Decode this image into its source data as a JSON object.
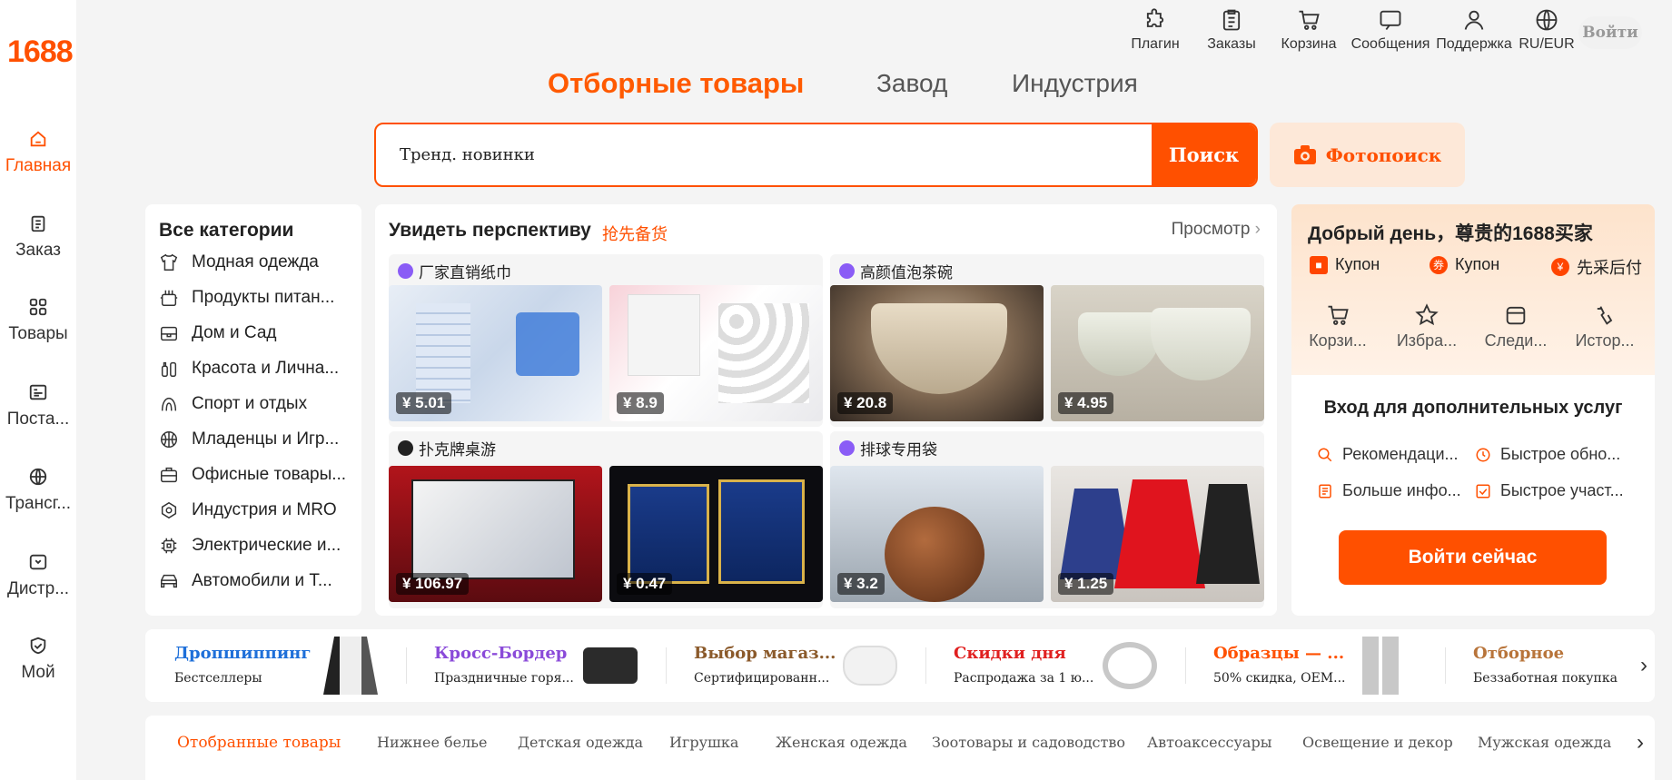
{
  "brand": {
    "logo": "1688"
  },
  "sidebar": {
    "items": [
      {
        "label": "Главная",
        "icon": "home-icon",
        "active": true
      },
      {
        "label": "Заказ",
        "icon": "clipboard-icon"
      },
      {
        "label": "Товары",
        "icon": "grid-icon"
      },
      {
        "label": "Поста...",
        "icon": "supplier-icon"
      },
      {
        "label": "Трансг...",
        "icon": "globe-icon"
      },
      {
        "label": "Дистр...",
        "icon": "distribution-icon"
      },
      {
        "label": "Мой",
        "icon": "user-badge-icon"
      }
    ]
  },
  "topbar": {
    "items": [
      {
        "label": "Плагин",
        "icon": "puzzle-icon"
      },
      {
        "label": "Заказы",
        "icon": "clipboard-icon"
      },
      {
        "label": "Корзина",
        "icon": "cart-icon"
      },
      {
        "label": "Сообщения",
        "icon": "message-icon"
      },
      {
        "label": "Поддержка",
        "icon": "person-icon"
      },
      {
        "label": "RU/EUR",
        "icon": "globe-icon"
      }
    ],
    "login": "Войти"
  },
  "tabs": {
    "selected": "Отборные товары",
    "factory": "Завод",
    "industry": "Индустрия"
  },
  "search": {
    "value": "Тренд. новинки",
    "button": "Поиск",
    "photo_button": "Фотопоиск"
  },
  "categories": {
    "title": "Все категории",
    "items": [
      {
        "label": "Модная одежда",
        "icon": "shirt-icon"
      },
      {
        "label": "Продукты питан...",
        "icon": "food-icon"
      },
      {
        "label": "Дом и Сад",
        "icon": "home-garden-icon"
      },
      {
        "label": "Красота и Лична...",
        "icon": "beauty-icon"
      },
      {
        "label": "Спорт и отдых",
        "icon": "sport-icon"
      },
      {
        "label": "Младенцы и Игр...",
        "icon": "ball-icon"
      },
      {
        "label": "Офисные товары...",
        "icon": "briefcase-icon"
      },
      {
        "label": "Индустрия и MRO",
        "icon": "industry-icon"
      },
      {
        "label": "Электрические и...",
        "icon": "chip-icon"
      },
      {
        "label": "Автомобили и Т...",
        "icon": "car-icon"
      }
    ]
  },
  "perspective": {
    "title": "Увидеть перспективу",
    "subtitle": "抢先备货",
    "more": "Просмотр",
    "groups": [
      {
        "label": "厂家直销纸巾",
        "products": [
          {
            "price": "¥ 5.01"
          },
          {
            "price": "¥ 8.9"
          }
        ]
      },
      {
        "label": "高颜值泡茶碗",
        "products": [
          {
            "price": "¥ 20.8"
          },
          {
            "price": "¥ 4.95"
          }
        ]
      },
      {
        "label": "扑克牌桌游",
        "products": [
          {
            "price": "¥ 106.97"
          },
          {
            "price": "¥ 0.47"
          }
        ]
      },
      {
        "label": "排球专用袋",
        "products": [
          {
            "price": "¥ 3.2"
          },
          {
            "price": "¥ 1.25"
          }
        ]
      }
    ]
  },
  "welcome": {
    "title": "Добрый день，尊贵的1688买家",
    "coupons": [
      "Купон",
      "Купон",
      "先采后付"
    ],
    "quick": [
      {
        "label": "Корзи...",
        "icon": "cart-icon"
      },
      {
        "label": "Избра...",
        "icon": "star-icon"
      },
      {
        "label": "Следи...",
        "icon": "shop-icon"
      },
      {
        "label": "Истор...",
        "icon": "history-icon"
      }
    ],
    "services_title": "Вход для дополнительных услуг",
    "services": [
      "Рекомендаци...",
      "Быстрое обно...",
      "Больше инфо...",
      "Быстрое участ..."
    ],
    "login_button": "Войти сейчас"
  },
  "promos": [
    {
      "title": "Дропшиппинг",
      "sub": "Бестселлеры",
      "color": "#1e6fd9"
    },
    {
      "title": "Кросс-Бордер",
      "sub": "Праздничные горя...",
      "color": "#8a4ad9"
    },
    {
      "title": "Выбор магаз...",
      "sub": "Сертифицированн...",
      "color": "#8b5a2b"
    },
    {
      "title": "Скидки дня",
      "sub": "Распродажа за 1 ю...",
      "color": "#e02020"
    },
    {
      "title": "Образцы — ...",
      "sub": "50% скидка, OEM...",
      "color": "#ff5000"
    },
    {
      "title": "Отборное",
      "sub": "Беззаботная покупка",
      "color": "#b8743a"
    }
  ],
  "category_tabs": [
    "Отобранные товары",
    "Нижнее белье",
    "Детская одежда",
    "Игрушка",
    "Женская одежда",
    "Зоотовары и садоводство",
    "Автоаксессуары",
    "Освещение и декор",
    "Мужская одежда"
  ],
  "colors": {
    "accent": "#ff5000"
  }
}
